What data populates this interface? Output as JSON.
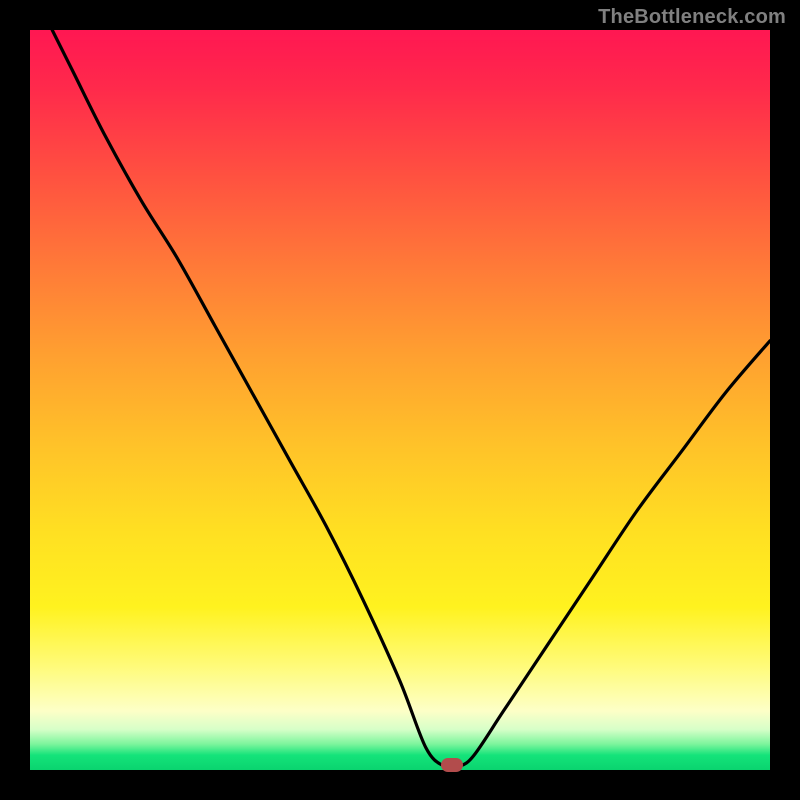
{
  "watermark": {
    "text": "TheBottleneck.com"
  },
  "chart_data": {
    "type": "line",
    "title": "",
    "xlabel": "",
    "ylabel": "",
    "xlim": [
      0,
      100
    ],
    "ylim": [
      0,
      100
    ],
    "grid": false,
    "legend": false,
    "series": [
      {
        "name": "curve",
        "x": [
          3,
          6,
          10,
          15,
          20,
          25,
          30,
          35,
          40,
          45,
          50,
          53.5,
          56,
          58,
          60,
          64,
          70,
          76,
          82,
          88,
          94,
          100
        ],
        "y": [
          100,
          94,
          86,
          77,
          69,
          60,
          51,
          42,
          33,
          23,
          12,
          3,
          0.5,
          0.5,
          2,
          8,
          17,
          26,
          35,
          43,
          51,
          58
        ]
      }
    ],
    "annotations": [
      {
        "name": "minimum-marker",
        "x": 57,
        "y": 0.7,
        "color": "#b24c4c"
      }
    ],
    "gradient_colors": {
      "top": "#ff1752",
      "mid_high": "#ffa030",
      "mid": "#fff21f",
      "low": "#0ad46f"
    }
  }
}
